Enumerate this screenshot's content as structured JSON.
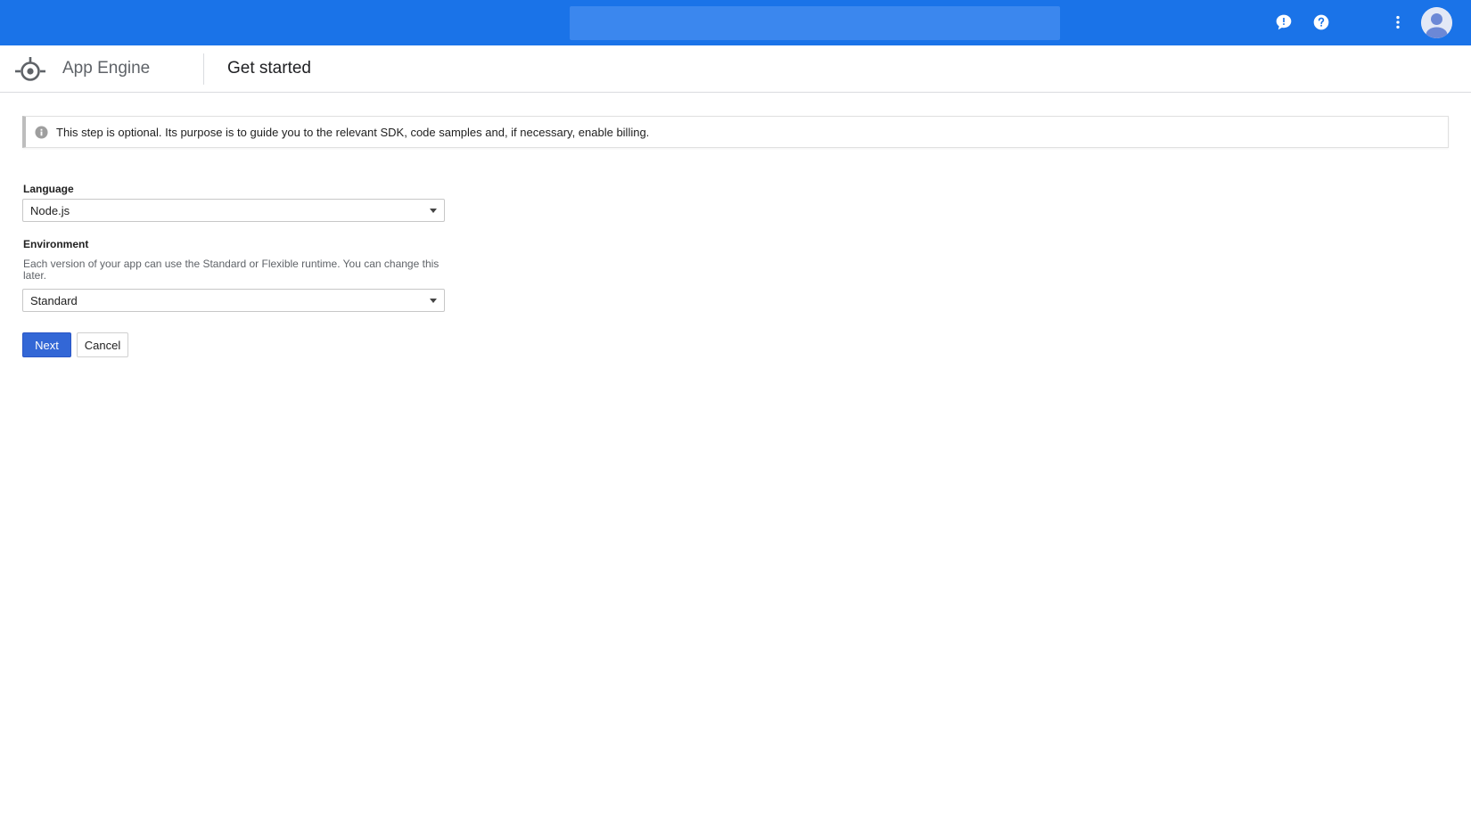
{
  "colors": {
    "topbar": "#1a73e8",
    "search": "#3b87ee",
    "primary_button": "#3367d6"
  },
  "topbar": {
    "icons": [
      "feedback-icon",
      "help-icon",
      "more-vert-icon",
      "account-avatar"
    ]
  },
  "header": {
    "product_name": "App Engine",
    "page_title": "Get started"
  },
  "banner": {
    "icon": "info-icon",
    "text": "This step is optional. Its purpose is to guide you to the relevant SDK, code samples and, if necessary, enable billing."
  },
  "form": {
    "language": {
      "label": "Language",
      "value": "Node.js"
    },
    "environment": {
      "label": "Environment",
      "help": "Each version of your app can use the Standard or Flexible runtime. You can change this later.",
      "value": "Standard"
    }
  },
  "actions": {
    "next_label": "Next",
    "cancel_label": "Cancel"
  }
}
